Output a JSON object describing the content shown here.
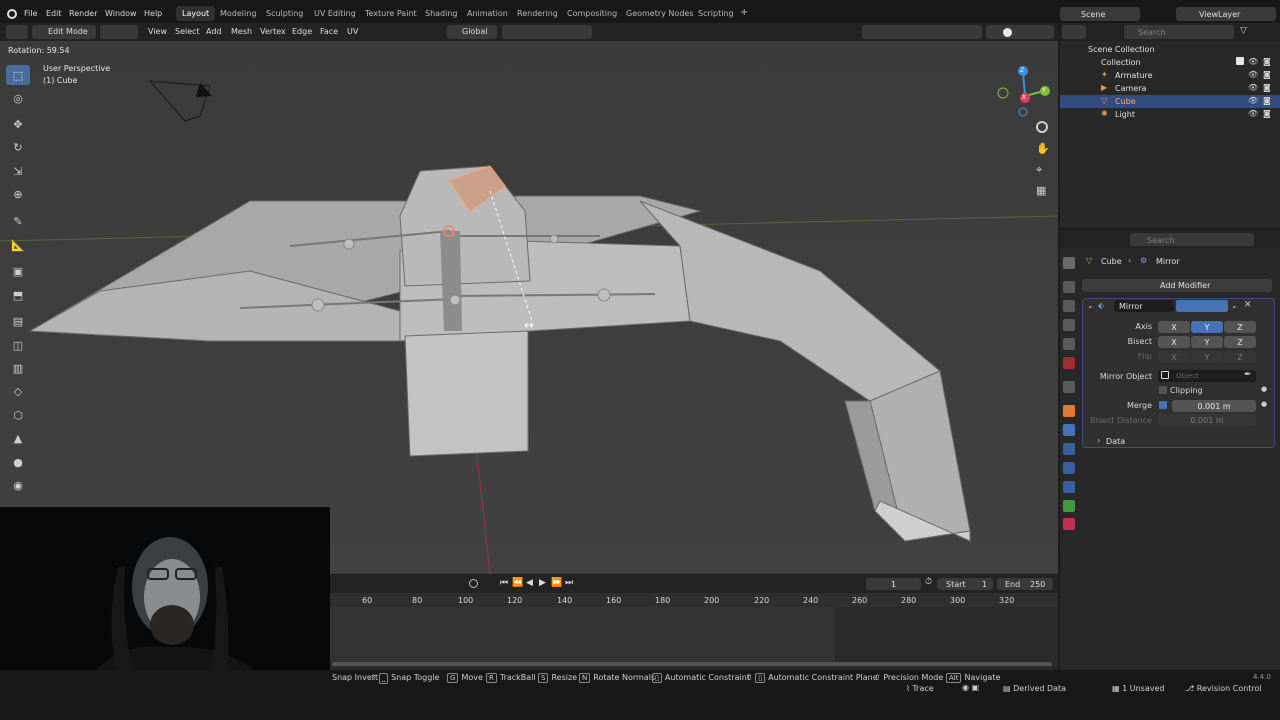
{
  "top_menu": [
    "File",
    "Edit",
    "Render",
    "Window",
    "Help"
  ],
  "workspaces": [
    "Layout",
    "Modeling",
    "Sculpting",
    "UV Editing",
    "Texture Paint",
    "Shading",
    "Animation",
    "Rendering",
    "Compositing",
    "Geometry Nodes",
    "Scripting",
    "+"
  ],
  "active_workspace": "Layout",
  "scene": {
    "label": "Scene",
    "view_layer": "ViewLayer"
  },
  "header2": {
    "mode": "Edit Mode",
    "menus": [
      "View",
      "Select",
      "Add",
      "Mesh",
      "Vertex",
      "Edge",
      "Face",
      "UV"
    ],
    "orientation": "Global"
  },
  "operator_info": "Rotation: 59.54",
  "viewport": {
    "perspective": "User Perspective",
    "object": "(1) Cube"
  },
  "gizmo_axes": [
    "Z",
    "Y",
    "X"
  ],
  "outliner": {
    "search_placeholder": "Search",
    "scene_collection": "Scene Collection",
    "collection": "Collection",
    "items": [
      {
        "name": "Armature",
        "selected": false
      },
      {
        "name": "Camera",
        "selected": false
      },
      {
        "name": "Cube",
        "selected": true
      },
      {
        "name": "Light",
        "selected": false
      }
    ]
  },
  "properties": {
    "search_placeholder": "Search",
    "breadcrumb_object": "Cube",
    "breadcrumb_modifier": "Mirror",
    "add_modifier": "Add Modifier",
    "modifier_name": "Mirror",
    "axis_label": "Axis",
    "bisect_label": "Bisect",
    "flip_label": "Flip",
    "axes": [
      "X",
      "Y",
      "Z"
    ],
    "axis_active": "Y",
    "mirror_object_label": "Mirror Object",
    "mirror_object_placeholder": "Object",
    "clipping_label": "Clipping",
    "merge_label": "Merge",
    "merge_value": "0.001 m",
    "bisect_distance_label": "Bisect Distance",
    "bisect_distance_value": "0.001 m",
    "data_panel": "Data"
  },
  "timeline": {
    "current_frame": "1",
    "start_label": "Start",
    "start": "1",
    "end_label": "End",
    "end": "250",
    "ticks": [
      "60",
      "80",
      "100",
      "120",
      "140",
      "160",
      "180",
      "200",
      "220",
      "240",
      "260",
      "280",
      "300",
      "320"
    ]
  },
  "statusbar": {
    "items": [
      {
        "key": "",
        "label": "Snap Invert"
      },
      {
        "key": "",
        "label": "Snap Toggle"
      },
      {
        "key": "G",
        "label": "Move"
      },
      {
        "key": "R",
        "label": "TrackBall"
      },
      {
        "key": "S",
        "label": "Resize"
      },
      {
        "key": "N",
        "label": "Rotate Normals"
      },
      {
        "key": "",
        "label": "Automatic Constraint"
      },
      {
        "key": "",
        "label": "Automatic Constraint Plane"
      },
      {
        "key": "",
        "label": "Precision Mode"
      },
      {
        "key": "Alt",
        "label": "Navigate"
      }
    ],
    "trace": "Trace",
    "derived": "Derived Data",
    "unsaved": "1 Unsaved",
    "revision": "Revision Control",
    "version": "4.4.0"
  },
  "colors": {
    "accent": "#4772b3",
    "x_axis": "#e0405a",
    "y_axis": "#7fbf3a",
    "z_axis": "#3f8fe0"
  }
}
